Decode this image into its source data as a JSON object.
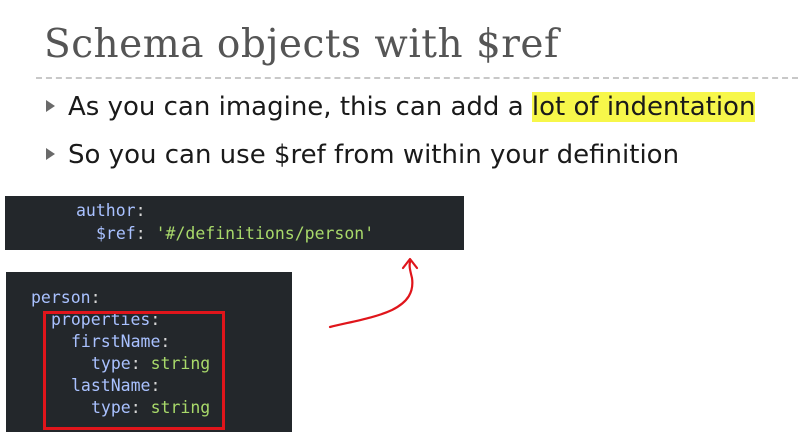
{
  "slide": {
    "title": "Schema objects with $ref",
    "bullets": [
      {
        "pre": "As you can imagine, this can add a ",
        "highlight": "lot of indentation"
      },
      {
        "pre": "So you can use $ref from within your definition",
        "highlight": ""
      }
    ]
  },
  "code_top": {
    "line1_key": "author",
    "line1_colon": ":",
    "line2_key": "$ref",
    "line2_colon": ":",
    "line2_value": "'#/definitions/person'"
  },
  "code_bottom": {
    "l1_key": "person",
    "l1_colon": ":",
    "l2_key": "properties",
    "l2_colon": ":",
    "l3_key": "firstName",
    "l3_colon": ":",
    "l4_key": "type",
    "l4_colon": ":",
    "l4_value": "string",
    "l5_key": "lastName",
    "l5_colon": ":",
    "l6_key": "type",
    "l6_colon": ":",
    "l6_value": "string"
  },
  "colors": {
    "highlight": "#f7f74a",
    "code_bg": "#23272b",
    "code_key": "#a9c1ff",
    "code_string": "#a8d96a",
    "annotation_red": "#e0151b"
  },
  "icons": {
    "bullet": "triangle-bullet-icon",
    "annotation": "red-curved-arrow-icon"
  }
}
